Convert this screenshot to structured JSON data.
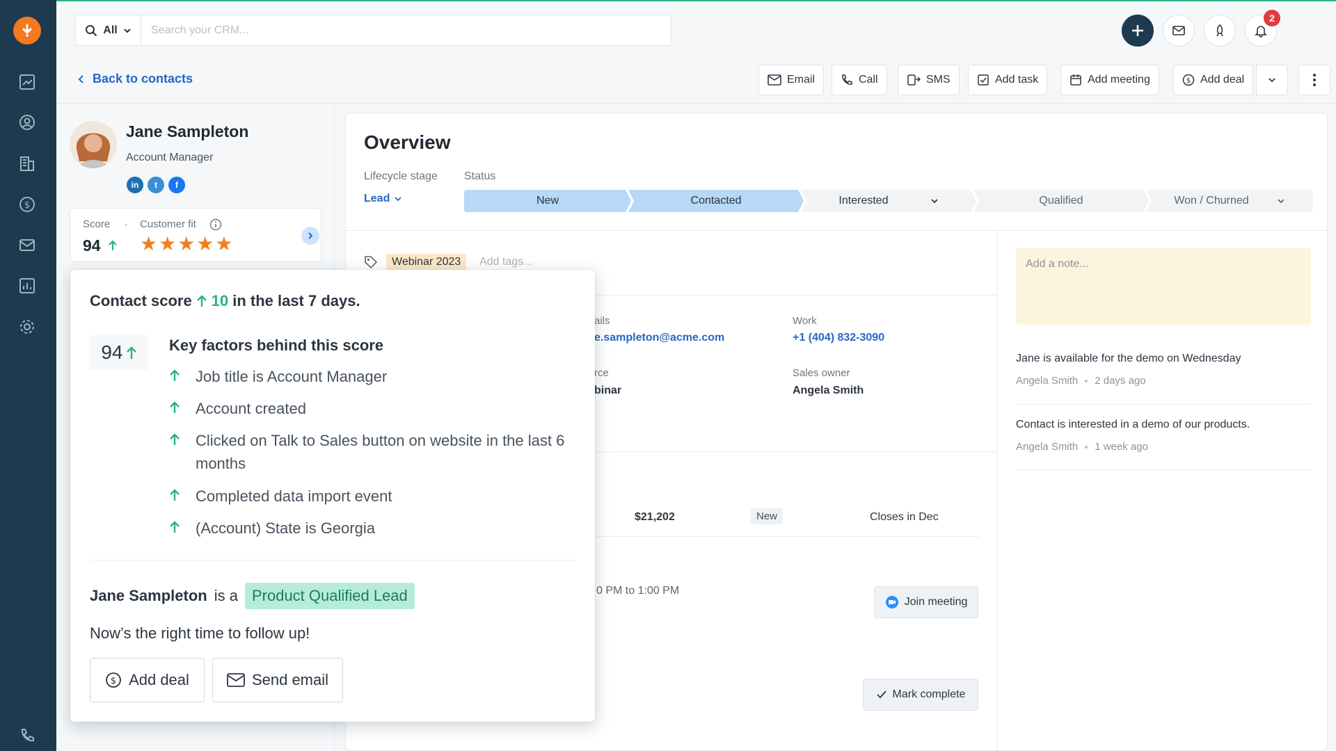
{
  "search": {
    "scope": "All",
    "placeholder": "Search your CRM..."
  },
  "topbar": {
    "notification_count": "2"
  },
  "back_link": "Back to contacts",
  "actions": {
    "email": "Email",
    "call": "Call",
    "sms": "SMS",
    "add_task": "Add task",
    "add_meeting": "Add meeting",
    "add_deal": "Add deal"
  },
  "contact": {
    "name": "Jane Sampleton",
    "title": "Account Manager",
    "social": [
      "in",
      "t",
      "f"
    ]
  },
  "score_card": {
    "score_label": "Score",
    "fit_label": "Customer fit",
    "score": "94",
    "stars": "★★★★★"
  },
  "overview": {
    "title": "Overview",
    "lifecycle_label": "Lifecycle stage",
    "status_label": "Status",
    "lifecycle_value": "Lead",
    "stages": [
      "New",
      "Contacted",
      "Interested",
      "Qualified",
      "Won / Churned"
    ],
    "tag": "Webinar 2023",
    "add_tags": "Add tags...",
    "emails_label": "ails",
    "email_value": "e.sampleton@acme.com",
    "work_label": "Work",
    "work_value": "+1 (404) 832-3090",
    "source_label": "rce",
    "source_value": "binar",
    "owner_label": "Sales owner",
    "owner_value": "Angela Smith"
  },
  "deal": {
    "amount": "$21,202",
    "stage": "New",
    "closes": "Closes in Dec"
  },
  "meeting": {
    "time": "0 PM to 1:00 PM",
    "join": "Join meeting"
  },
  "task": {
    "mark_complete": "Mark complete"
  },
  "notes": {
    "placeholder": "Add a note...",
    "items": [
      {
        "text": "Jane is available for the demo on Wednesday",
        "author": "Angela Smith",
        "when": "2 days ago"
      },
      {
        "text": "Contact is interested in a demo of our products.",
        "author": "Angela Smith",
        "when": "1 week ago"
      }
    ]
  },
  "popover": {
    "head_prefix": "Contact score",
    "delta": "10",
    "head_suffix": "in the last 7 days.",
    "score": "94",
    "factors_title": "Key factors behind this score",
    "factors": [
      "Job title is Account Manager",
      "Account created",
      "Clicked on Talk to Sales button on website in the last 6 months",
      "Completed data import event",
      "(Account) State is Georgia"
    ],
    "pql_name": "Jane Sampleton",
    "pql_is": "is a",
    "pql_label": "Product Qualified Lead",
    "follow_up": "Now’s the right time to follow up!",
    "add_deal": "Add deal",
    "send_email": "Send email"
  },
  "colors": {
    "sidebar": "#1d3a4f",
    "accent_green": "#27b38a",
    "link_blue": "#2667c6",
    "brand_orange": "#f47a20",
    "star_orange": "#f07f1e"
  }
}
